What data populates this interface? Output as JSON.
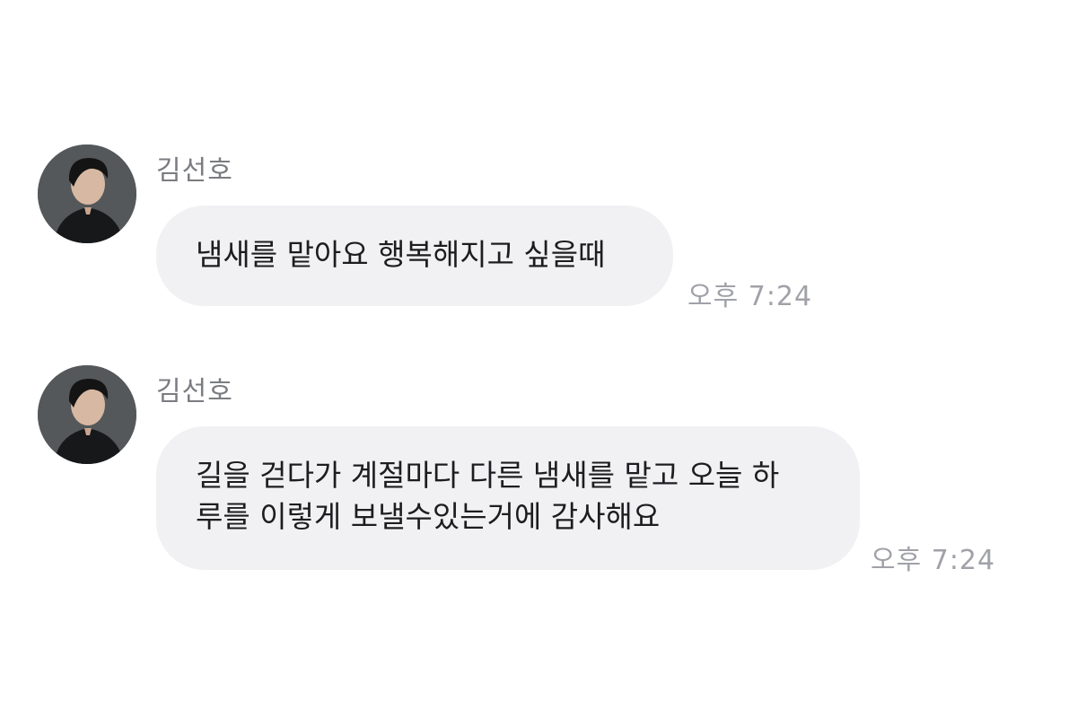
{
  "messages": [
    {
      "sender": "김선호",
      "lines": [
        "냄새를 맡아요 행복해지고 싶을때"
      ],
      "time": "오후 7:24"
    },
    {
      "sender": "김선호",
      "lines": [
        "길을 걷다가 계절마다 다른 냄새를 맡고 오늘 하",
        "루를 이렇게 보낼수있는거에 감사해요"
      ],
      "time": "오후 7:24"
    }
  ],
  "colors": {
    "background": "#ffffff",
    "bubble": "#f1f1f4",
    "message_text": "#1d1d1f",
    "sender_text": "#7a7c80",
    "time_text": "#a0a2a8",
    "avatar_bg": "#54585a"
  },
  "icons": {
    "avatar": "profile-photo"
  }
}
